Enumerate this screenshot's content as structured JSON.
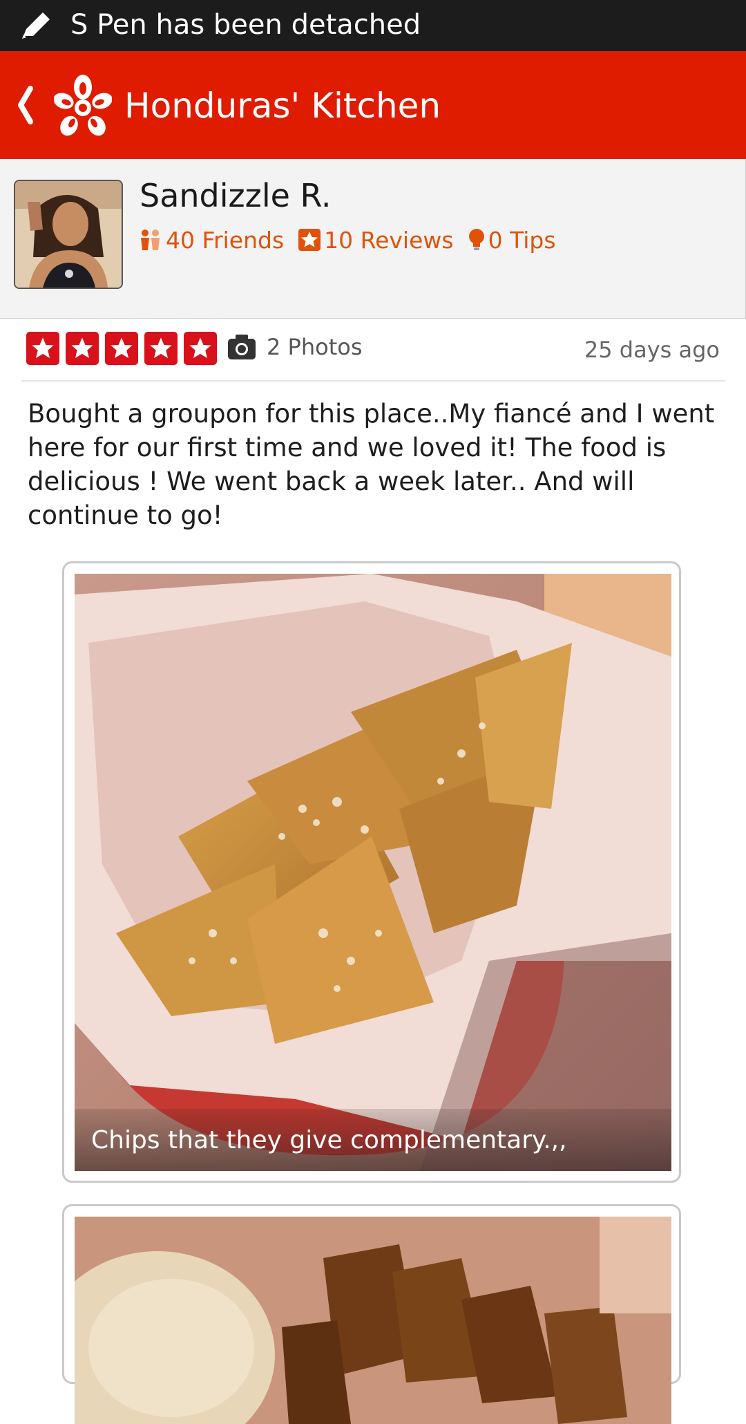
{
  "status_bar": {
    "message": "S Pen has been detached",
    "icon": "pen-icon"
  },
  "app_bar": {
    "title": "Honduras' Kitchen",
    "back_icon": "back-chevron-icon",
    "logo_icon": "yelp-burst-logo",
    "background_color": "#df1c00"
  },
  "user": {
    "name": "Sandizzle R.",
    "friends": "40 Friends",
    "reviews": "10 Reviews",
    "tips": "0 Tips",
    "stat_color": "#e0520a"
  },
  "review": {
    "rating": 5,
    "rating_max": 5,
    "star_color": "#d8111b",
    "photos": "2 Photos",
    "date": "25 days ago",
    "text": "Bought a groupon for this place..My fiancé and I went here for our first time and we loved it! The food is delicious ! We went back a week later.. And will continue to go!"
  },
  "photos": [
    {
      "caption": "Chips that they give complementary.,,"
    },
    {
      "caption": ""
    }
  ]
}
